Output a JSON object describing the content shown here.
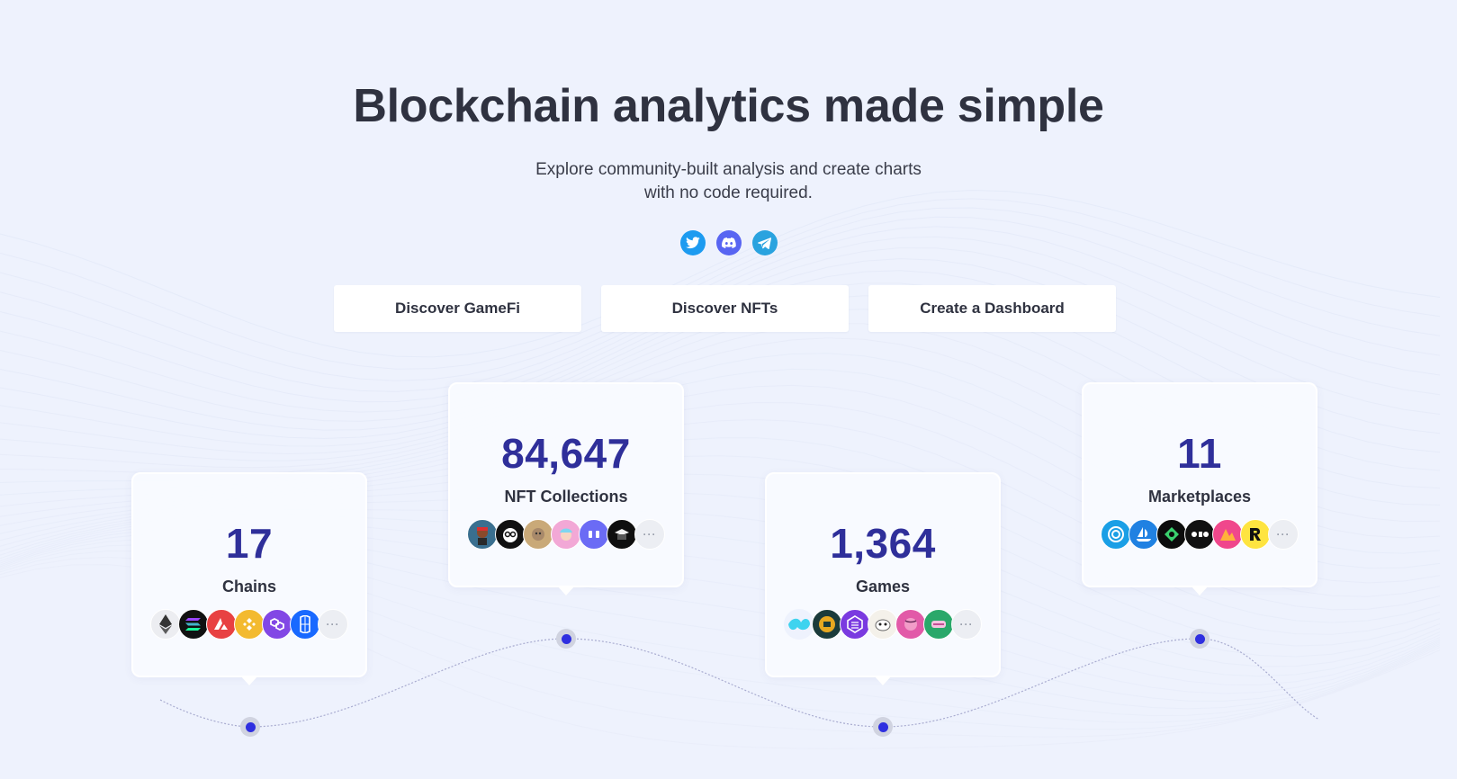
{
  "hero": {
    "title": "Blockchain analytics made simple",
    "subtitle_line1": "Explore community-built analysis and create charts",
    "subtitle_line2": "with no code required."
  },
  "socials": [
    {
      "name": "twitter-icon",
      "color": "#1d9bf0"
    },
    {
      "name": "discord-icon",
      "color": "#5865f2"
    },
    {
      "name": "telegram-icon",
      "color": "#2aa3df"
    }
  ],
  "cta": {
    "gamefi_label": "Discover GameFi",
    "nfts_label": "Discover NFTs",
    "dashboard_label": "Create a Dashboard"
  },
  "stats": {
    "chains": {
      "value": "17",
      "label": "Chains",
      "icons": [
        "ethereum-icon",
        "solana-icon",
        "avalanche-icon",
        "bnb-icon",
        "polygon-icon",
        "fantom-icon"
      ]
    },
    "nft": {
      "value": "84,647",
      "label": "NFT Collections",
      "icons": [
        "nft-avatar-1-icon",
        "nft-avatar-2-icon",
        "nft-avatar-3-icon",
        "nft-avatar-4-icon",
        "nft-avatar-5-icon",
        "nft-avatar-6-icon"
      ]
    },
    "games": {
      "value": "1,364",
      "label": "Games",
      "icons": [
        "game-1-icon",
        "game-2-icon",
        "game-3-icon",
        "game-4-icon",
        "game-5-icon",
        "game-6-icon"
      ]
    },
    "marketplaces": {
      "value": "11",
      "label": "Marketplaces",
      "icons": [
        "marketplace-1-icon",
        "opensea-icon",
        "marketplace-3-icon",
        "marketplace-4-icon",
        "marketplace-5-icon",
        "rarible-icon"
      ]
    }
  },
  "more_glyph": "···",
  "colors": {
    "accent_number": "#2f2f9a",
    "timeline_dot": "#2f2fe0",
    "background": "#eef2fd"
  }
}
